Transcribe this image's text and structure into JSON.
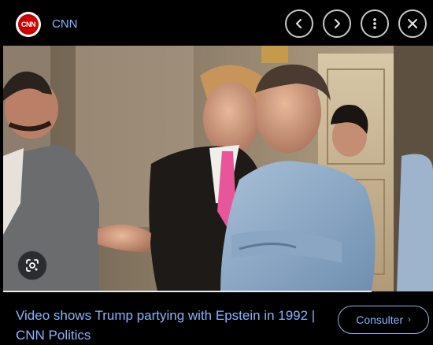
{
  "header": {
    "source_name": "CNN",
    "logo_text": "CNN",
    "controls": [
      {
        "name": "previous-button",
        "icon": "chevron-left-icon"
      },
      {
        "name": "next-button",
        "icon": "chevron-right-icon"
      },
      {
        "name": "more-options-button",
        "icon": "more-vert-icon"
      },
      {
        "name": "close-button",
        "icon": "close-icon"
      }
    ]
  },
  "image": {
    "lens_icon": "google-lens-icon"
  },
  "footer": {
    "caption": "Video shows Trump partying with Epstein in 1992 | CNN Politics",
    "visit_label": "Consulter",
    "visit_chevron": "›"
  },
  "colors": {
    "accent": "#8ab4f8",
    "background": "#000000",
    "cnn_red": "#cc0000"
  }
}
